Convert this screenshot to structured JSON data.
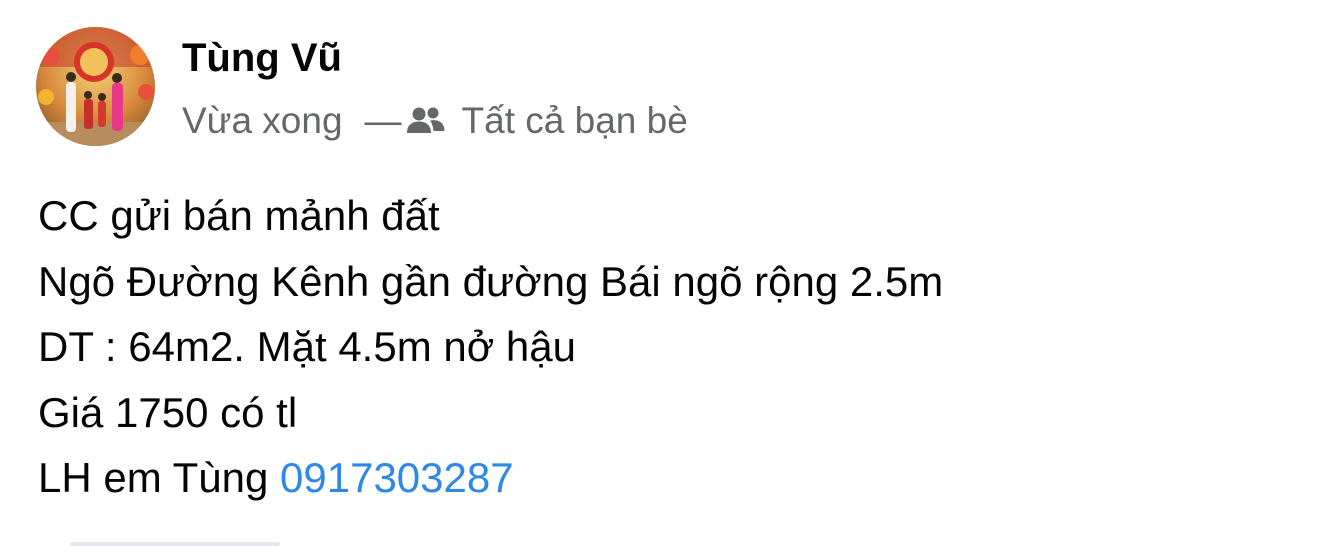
{
  "post": {
    "author_name": "Tùng Vũ",
    "timestamp": "Vừa xong",
    "separator": "—",
    "audience_icon": "friends-icon",
    "audience_label": "Tất cả bạn bè",
    "body": {
      "line1": "CC gửi bán mảnh đất",
      "line2": "Ngõ Đường Kênh gần đường Bái ngõ rộng 2.5m",
      "line3": "DT : 64m2. Mặt 4.5m nở hậu",
      "line4": "Giá 1750 có tl",
      "line5_prefix": "LH em Tùng ",
      "phone": "0917303287"
    }
  },
  "colors": {
    "text": "#050505",
    "secondary_text": "#65676b",
    "link": "#2d88e6",
    "background": "#ffffff"
  }
}
